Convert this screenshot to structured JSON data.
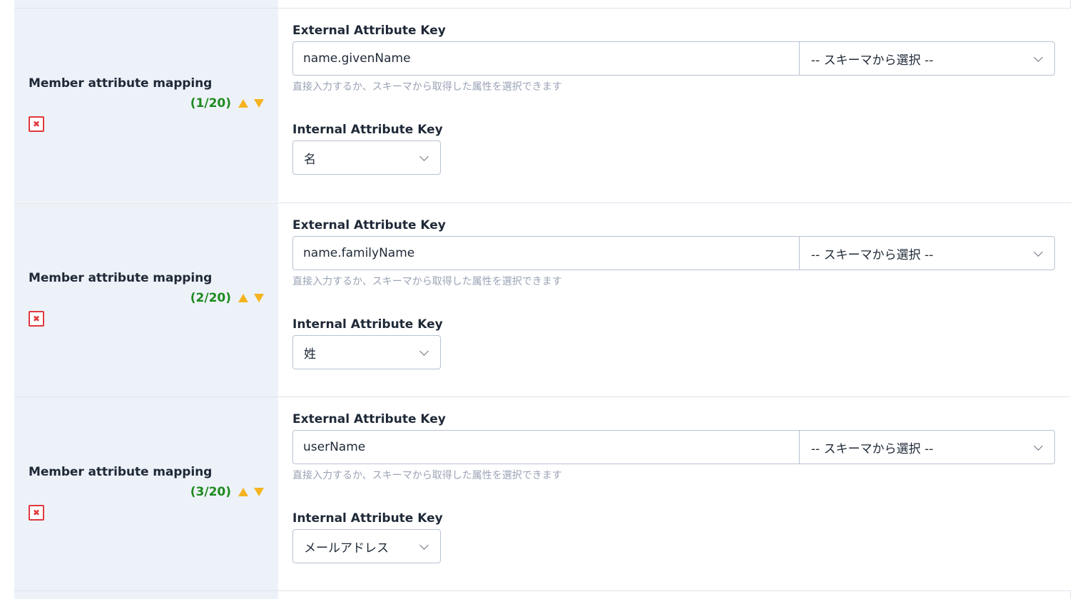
{
  "mappings": [
    {
      "title": "Member attribute mapping",
      "counter": "(1/20)",
      "external_label": "External Attribute Key",
      "external_value": "name.givenName",
      "schema_select": "-- スキーマから選択 --",
      "hint": "直接入力するか、スキーマから取得した属性を選択できます",
      "internal_label": "Internal Attribute Key",
      "internal_value": "名"
    },
    {
      "title": "Member attribute mapping",
      "counter": "(2/20)",
      "external_label": "External Attribute Key",
      "external_value": "name.familyName",
      "schema_select": "-- スキーマから選択 --",
      "hint": "直接入力するか、スキーマから取得した属性を選択できます",
      "internal_label": "Internal Attribute Key",
      "internal_value": "姓"
    },
    {
      "title": "Member attribute mapping",
      "counter": "(3/20)",
      "external_label": "External Attribute Key",
      "external_value": "userName",
      "schema_select": "-- スキーマから選択 --",
      "hint": "直接入力するか、スキーマから取得した属性を選択できます",
      "internal_label": "Internal Attribute Key",
      "internal_value": "メールアドレス"
    }
  ],
  "colors": {
    "counter": "#1e8a1e",
    "arrows": "#f5b320",
    "remove": "#e0393e",
    "left_panel": "#edf2f9"
  },
  "icons": {
    "move_up": "triangle-up-icon",
    "move_down": "triangle-down-icon",
    "remove": "close-icon",
    "dropdown": "chevron-down-icon"
  }
}
